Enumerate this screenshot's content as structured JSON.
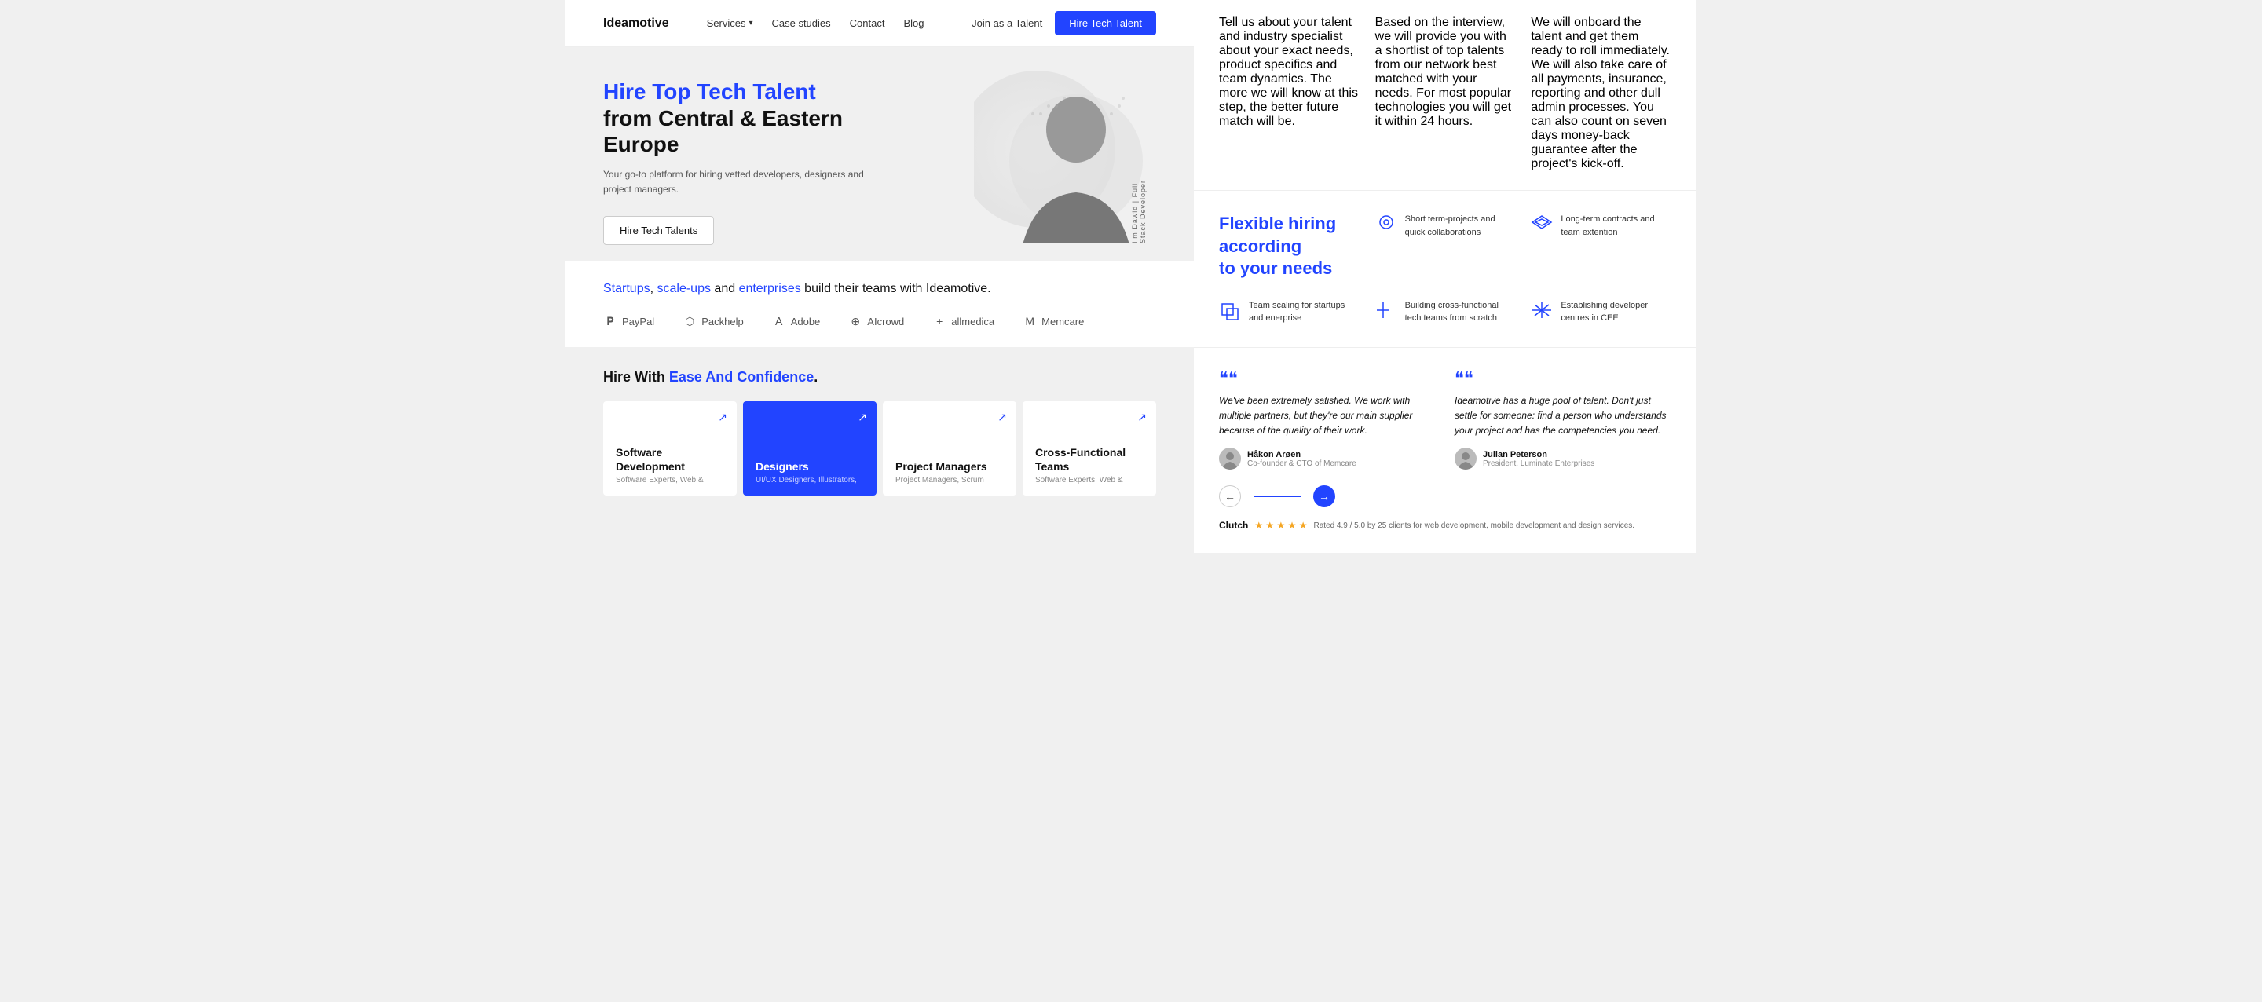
{
  "nav": {
    "logo": "Ideamotive",
    "links": [
      {
        "label": "Services",
        "has_dropdown": true
      },
      {
        "label": "Case studies"
      },
      {
        "label": "Contact"
      },
      {
        "label": "Blog"
      }
    ],
    "join_talent": "Join as a Talent",
    "hire_btn": "Hire Tech Talent"
  },
  "hero": {
    "title_blue": "Hire Top Tech Talent",
    "title_rest": " from Central & Eastern Europe",
    "subtitle": "Your go-to platform for hiring vetted developers, designers and project managers.",
    "cta": "Hire Tech Talents",
    "person_label": "I'm Dawid | Full Stack Developer"
  },
  "brands": {
    "heading_blue1": "Startups",
    "heading_mid1": ", ",
    "heading_blue2": "scale-ups",
    "heading_mid2": " and ",
    "heading_blue3": "enterprises",
    "heading_rest": " build their teams with Ideamotive.",
    "logos": [
      {
        "name": "PayPal",
        "icon": "💳"
      },
      {
        "name": "Packhelp",
        "icon": "📦"
      },
      {
        "name": "Adobe",
        "icon": "🅰"
      },
      {
        "name": "AIcrowd",
        "icon": "🤖"
      },
      {
        "name": "allmedica",
        "icon": "➕"
      },
      {
        "name": "Memcare",
        "icon": "M"
      }
    ]
  },
  "hire_section": {
    "title_normal": "Hire With ",
    "title_blue": "Ease And Confidence",
    "title_end": ".",
    "cards": [
      {
        "title": "Software\nDevelopment",
        "subtitle": "Software Experts, Web &",
        "blue": false
      },
      {
        "title": "Designers",
        "subtitle": "UI/UX Designers, Illustrators,",
        "blue": true
      },
      {
        "title": "Project Managers",
        "subtitle": "Project Managers, Scrum",
        "blue": false
      },
      {
        "title": "Cross-Functional\nTeams",
        "subtitle": "Software Experts, Web &",
        "blue": false
      }
    ]
  },
  "process": {
    "cols": [
      "Tell us about your talent and industry specialist about your exact needs, product specifics and team dynamics. The more we will know at this step, the better future match will be.",
      "Based on the interview, we will provide you with a shortlist of top talents from our network best matched with your needs. For most popular technologies you will get it within 24 hours.",
      "We will onboard the talent and get them ready to roll immediately. We will also take care of all payments, insurance, reporting and other dull admin processes. You can also count on seven days money-back guarantee after the project's kick-off."
    ]
  },
  "flexible": {
    "title": "Flexible hiring\naccording\nto your needs",
    "items_top": [
      {
        "icon": "⊙",
        "text": "Short term-projects and quick collaborations"
      },
      {
        "icon": "✳",
        "text": "Long-term contracts and team extention"
      }
    ],
    "items_bottom": [
      {
        "icon": "▣",
        "text": "Team scaling for startups and enerprise"
      },
      {
        "icon": "+",
        "text": "Building cross-functional tech teams from scratch"
      },
      {
        "icon": "✦",
        "text": "Establishing developer centres in CEE"
      }
    ]
  },
  "testimonials": {
    "items": [
      {
        "quote": "❝❝",
        "text": "We've been extremely satisfied. We work with multiple partners, but they're our main supplier because of the quality of their work.",
        "author_name": "Håkon Arøen",
        "author_role": "Co-founder & CTO of Memcare",
        "avatar": "H"
      },
      {
        "quote": "❝❝",
        "text": "Ideamotive has a huge pool of talent. Don't just settle for someone: find a person who understands your project and has the competencies you need.",
        "author_name": "Julian Peterson",
        "author_role": "President, Luminate Enterprises",
        "avatar": "J"
      }
    ],
    "nav": {
      "prev": "←",
      "next": "→"
    },
    "clutch": {
      "brand": "Clutch",
      "stars": "★ ★ ★ ★ ★",
      "desc": "Rated 4.9 / 5.0 by 25 clients for web development, mobile development and design services."
    }
  }
}
